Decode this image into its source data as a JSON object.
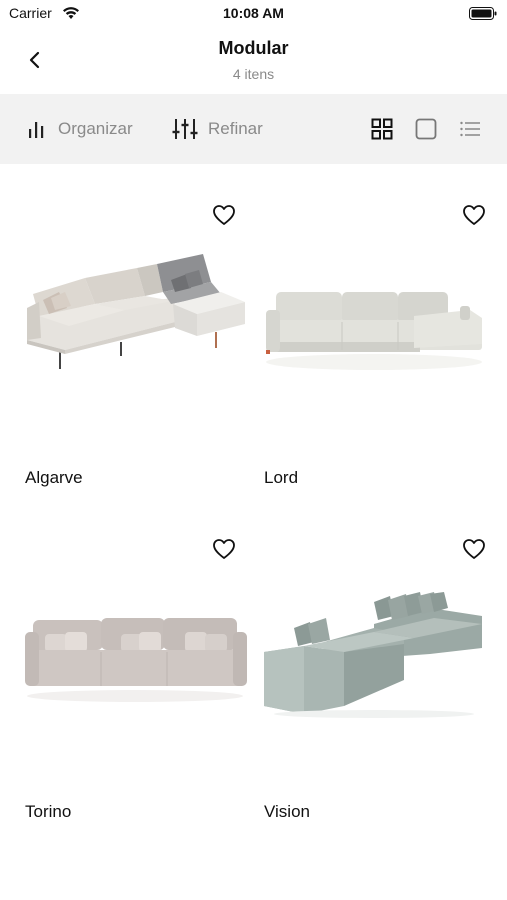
{
  "status_bar": {
    "carrier": "Carrier",
    "time": "10:08 AM"
  },
  "header": {
    "title": "Modular",
    "subtitle": "4 itens",
    "back_icon": "chevron-left-icon"
  },
  "toolbar": {
    "organize_label": "Organizar",
    "refine_label": "Refinar",
    "views": [
      "grid-view-icon",
      "single-view-icon",
      "list-view-icon"
    ]
  },
  "products": [
    {
      "name": "Algarve",
      "favorite": false,
      "image": "sectional-sofa-with-chaise"
    },
    {
      "name": "Lord",
      "favorite": false,
      "image": "sectional-sofa-light-gray"
    },
    {
      "name": "Torino",
      "favorite": false,
      "image": "three-seat-sofa-beige"
    },
    {
      "name": "Vision",
      "favorite": false,
      "image": "modular-sofa-sage-green"
    }
  ],
  "colors": {
    "toolbar_bg": "#f2f2f2",
    "muted_text": "#8a8a8a",
    "text": "#111111"
  }
}
